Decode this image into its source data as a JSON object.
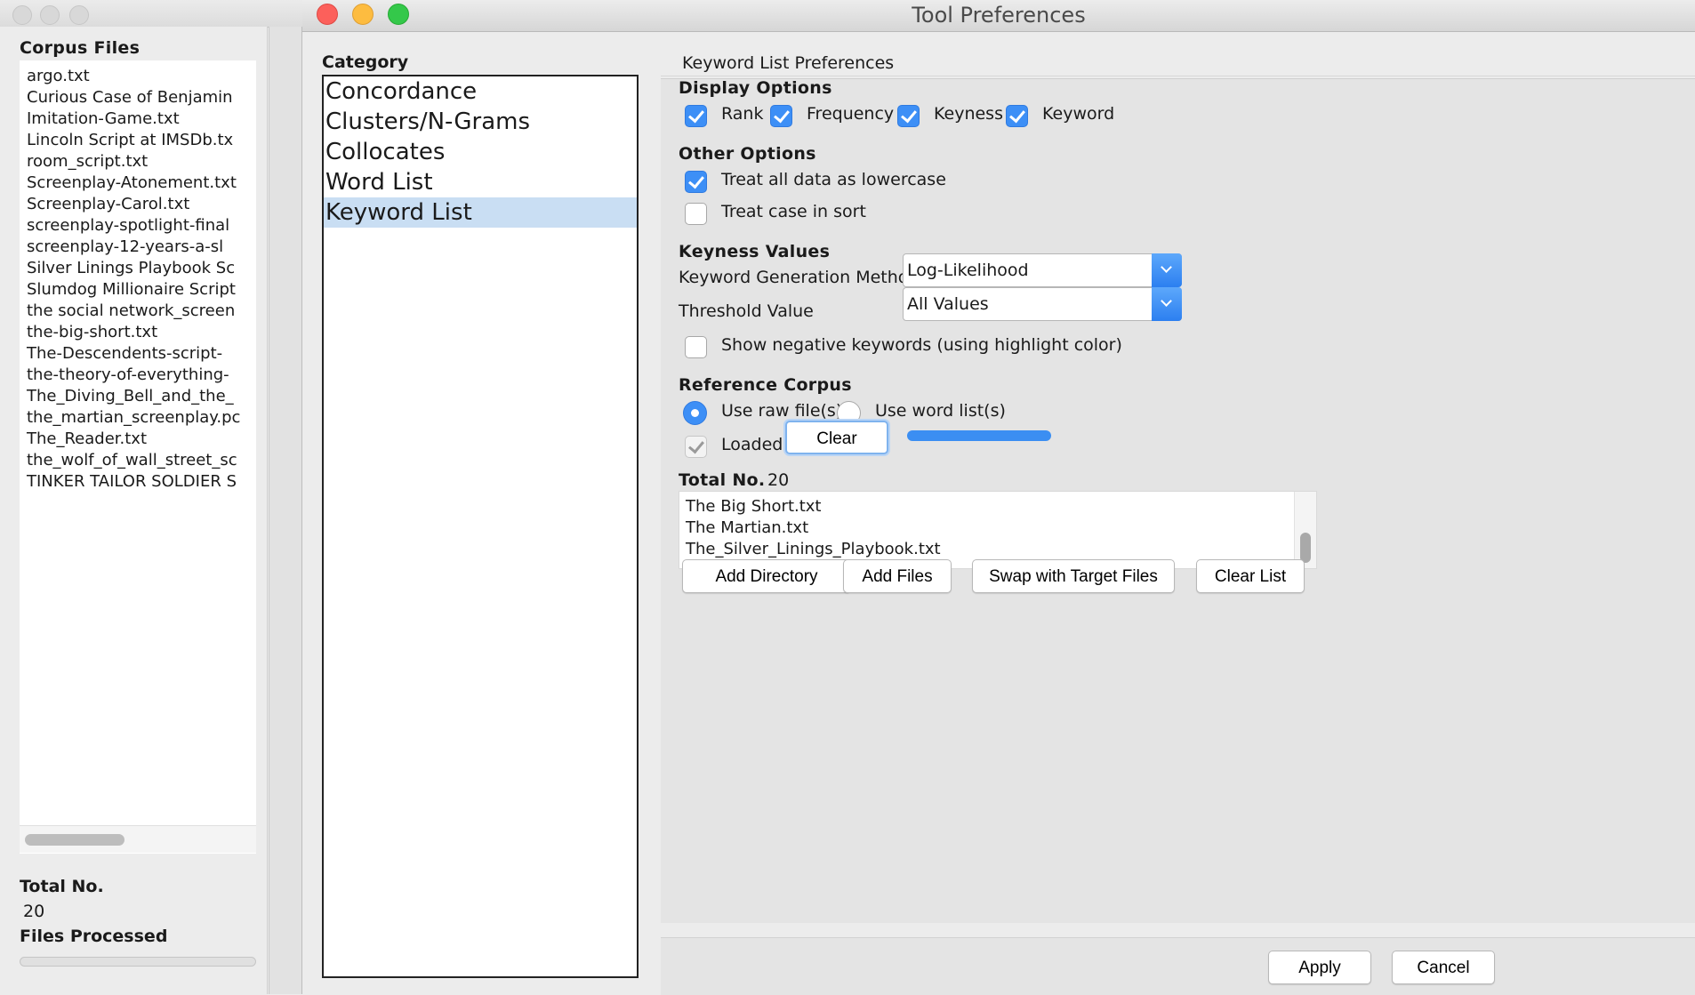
{
  "background_window": {
    "corpus_files_heading": "Corpus Files",
    "files": [
      "argo.txt",
      "Curious Case of Benjamin",
      "Imitation-Game.txt",
      "Lincoln Script at IMSDb.tx",
      "room_script.txt",
      "Screenplay-Atonement.txt",
      "Screenplay-Carol.txt",
      "screenplay-spotlight-final",
      "screenplay-12-years-a-sl",
      "Silver Linings Playbook Sc",
      "Slumdog Millionaire Script",
      "the social network_screen",
      "the-big-short.txt",
      "The-Descendents-script-",
      "the-theory-of-everything-",
      "The_Diving_Bell_and_the_",
      "the_martian_screenplay.pc",
      "The_Reader.txt",
      "the_wolf_of_wall_street_sc",
      "TINKER TAILOR SOLDIER S"
    ],
    "total_label": "Total No.",
    "total_value": "20",
    "files_processed_label": "Files Processed",
    "files_processed_progress": 0
  },
  "window": {
    "title": "Tool Preferences"
  },
  "category": {
    "header": "Category",
    "items": [
      "Concordance",
      "Clusters/N-Grams",
      "Collocates",
      "Word List",
      "Keyword List"
    ],
    "selected": "Keyword List"
  },
  "prefs": {
    "tab_label": "Keyword List Preferences",
    "display_options": {
      "title": "Display Options",
      "rank": {
        "label": "Rank",
        "checked": true
      },
      "frequency": {
        "label": "Frequency",
        "checked": true
      },
      "keyness": {
        "label": "Keyness",
        "checked": true
      },
      "keyword": {
        "label": "Keyword",
        "checked": true
      }
    },
    "other_options": {
      "title": "Other Options",
      "lowercase": {
        "label": "Treat all data as lowercase",
        "checked": true
      },
      "case_in_sort": {
        "label": "Treat case in sort",
        "checked": false
      }
    },
    "keyness_values": {
      "title": "Keyness Values",
      "method_label": "Keyword Generation Method",
      "method_value": "Log-Likelihood",
      "threshold_label": "Threshold Value",
      "threshold_value": "All Values",
      "negative": {
        "label": "Show negative keywords (using highlight color)",
        "checked": false
      }
    },
    "reference_corpus": {
      "title": "Reference Corpus",
      "raw_files": {
        "label": "Use raw file(s)",
        "selected": true
      },
      "word_lists": {
        "label": "Use word list(s)",
        "selected": false
      },
      "loaded": {
        "label": "Loaded",
        "checked": true
      },
      "clear_button": "Clear",
      "load_progress": 1.0,
      "total_label": "Total No.",
      "total_value": "20",
      "files": [
        "The Big Short.txt",
        "The Martian.txt",
        "The_Silver_Linings_Playbook.txt"
      ],
      "add_directory": "Add Directory",
      "add_files": "Add Files",
      "swap_files": "Swap with Target Files",
      "clear_list": "Clear List"
    }
  },
  "footer": {
    "apply": "Apply",
    "cancel": "Cancel"
  },
  "colors": {
    "accent": "#3d8ff6",
    "selection": "#c9def3",
    "close_light": "#fc605b",
    "minimize_light": "#fdbc40",
    "maximize_light": "#34c84a"
  }
}
